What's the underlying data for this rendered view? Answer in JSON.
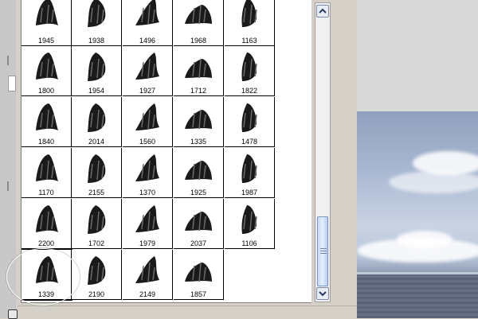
{
  "brush_picker": {
    "brushes": [
      {
        "size": "1945"
      },
      {
        "size": "1938"
      },
      {
        "size": "1496"
      },
      {
        "size": "1968"
      },
      {
        "size": "1163"
      },
      {
        "size": "1800"
      },
      {
        "size": "1954"
      },
      {
        "size": "1927"
      },
      {
        "size": "1712"
      },
      {
        "size": "1822"
      },
      {
        "size": "1840"
      },
      {
        "size": "2014"
      },
      {
        "size": "1560"
      },
      {
        "size": "1335"
      },
      {
        "size": "1478"
      },
      {
        "size": "1170"
      },
      {
        "size": "2155"
      },
      {
        "size": "1370"
      },
      {
        "size": "1925"
      },
      {
        "size": "1987"
      },
      {
        "size": "2200"
      },
      {
        "size": "1702"
      },
      {
        "size": "1979"
      },
      {
        "size": "2037"
      },
      {
        "size": "1106"
      },
      {
        "size": "1339"
      },
      {
        "size": "2190"
      },
      {
        "size": "2149"
      },
      {
        "size": "1857"
      }
    ],
    "selected_size": "1339"
  },
  "scrollbar": {
    "up_icon": "arrow-up-icon",
    "down_icon": "arrow-down-icon"
  },
  "colors": {
    "panel_bg": "#d4d0c8",
    "grid_bg": "#ffffff",
    "scroll_thumb": "#c7d9f5",
    "highlight_circle": "#ffffff"
  }
}
